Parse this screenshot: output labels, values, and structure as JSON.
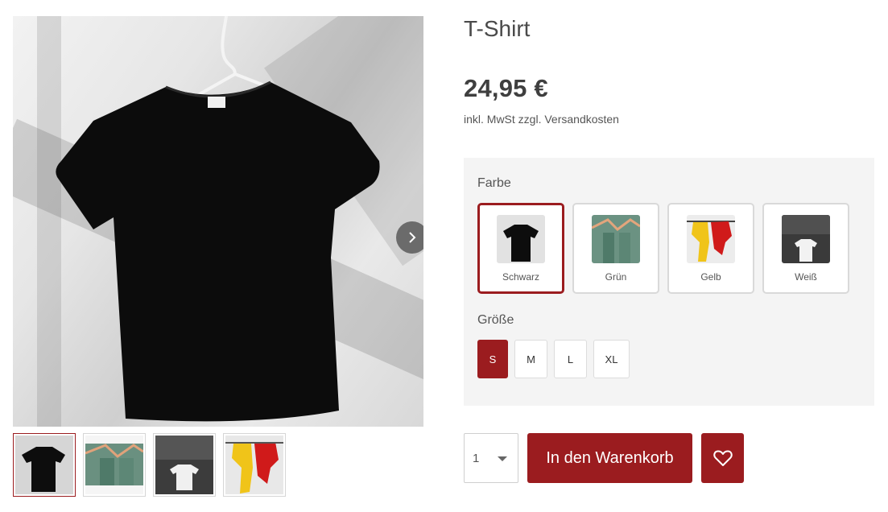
{
  "product": {
    "title": "T-Shirt",
    "price": "24,95 €",
    "tax_note": "inkl. MwSt zzgl. Versandkosten"
  },
  "gallery": {
    "next_icon": "chevron-right-icon",
    "thumbnails": [
      {
        "color": "Schwarz",
        "active": true
      },
      {
        "color": "Grün",
        "active": false
      },
      {
        "color": "Weiß",
        "active": false
      },
      {
        "color": "Gelb",
        "active": false
      }
    ]
  },
  "config": {
    "color_label": "Farbe",
    "colors": [
      {
        "label": "Schwarz",
        "selected": true,
        "hex": "#111111"
      },
      {
        "label": "Grün",
        "selected": false,
        "hex": "#5e8a78"
      },
      {
        "label": "Gelb",
        "selected": false,
        "hex": "#f2c21a"
      },
      {
        "label": "Weiß",
        "selected": false,
        "hex": "#f2f2f2"
      }
    ],
    "size_label": "Größe",
    "sizes": [
      {
        "label": "S",
        "selected": true
      },
      {
        "label": "M",
        "selected": false
      },
      {
        "label": "L",
        "selected": false
      },
      {
        "label": "XL",
        "selected": false
      }
    ]
  },
  "buy": {
    "quantity": "1",
    "cart_label": "In den Warenkorb",
    "wishlist_icon": "heart-icon"
  },
  "theme": {
    "accent": "#9b1c1f",
    "panel_bg": "#f4f4f4"
  }
}
